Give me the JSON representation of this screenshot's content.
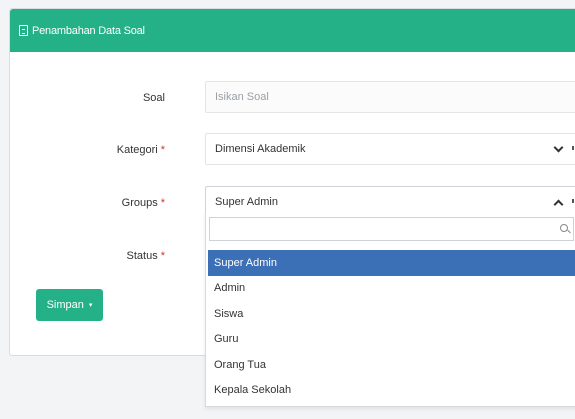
{
  "panel": {
    "title": "Penambahan Data Soal"
  },
  "form": {
    "soal": {
      "label": "Soal",
      "placeholder": "Isikan Soal",
      "value": ""
    },
    "kategori": {
      "label": "Kategori",
      "required_mark": "*",
      "value": "Dimensi Akademik"
    },
    "groups": {
      "label": "Groups",
      "required_mark": "*",
      "value": "Super Admin"
    },
    "status": {
      "label": "Status",
      "required_mark": "*"
    }
  },
  "submit_button": {
    "label": "Simpan",
    "caret": "▾"
  },
  "groups_dropdown": {
    "search_value": "",
    "options": [
      "Super Admin",
      "Admin",
      "Siswa",
      "Guru",
      "Orang Tua",
      "Kepala Sekolah"
    ],
    "selected": "Super Admin"
  },
  "colors": {
    "accent": "#25b187",
    "selected_option": "#3b6fb6",
    "required": "#d9302c"
  },
  "icons": {
    "header": "document-icon",
    "kategori_toggle": "chevron-down-icon",
    "groups_toggle": "chevron-up-icon",
    "search": "search-icon"
  }
}
